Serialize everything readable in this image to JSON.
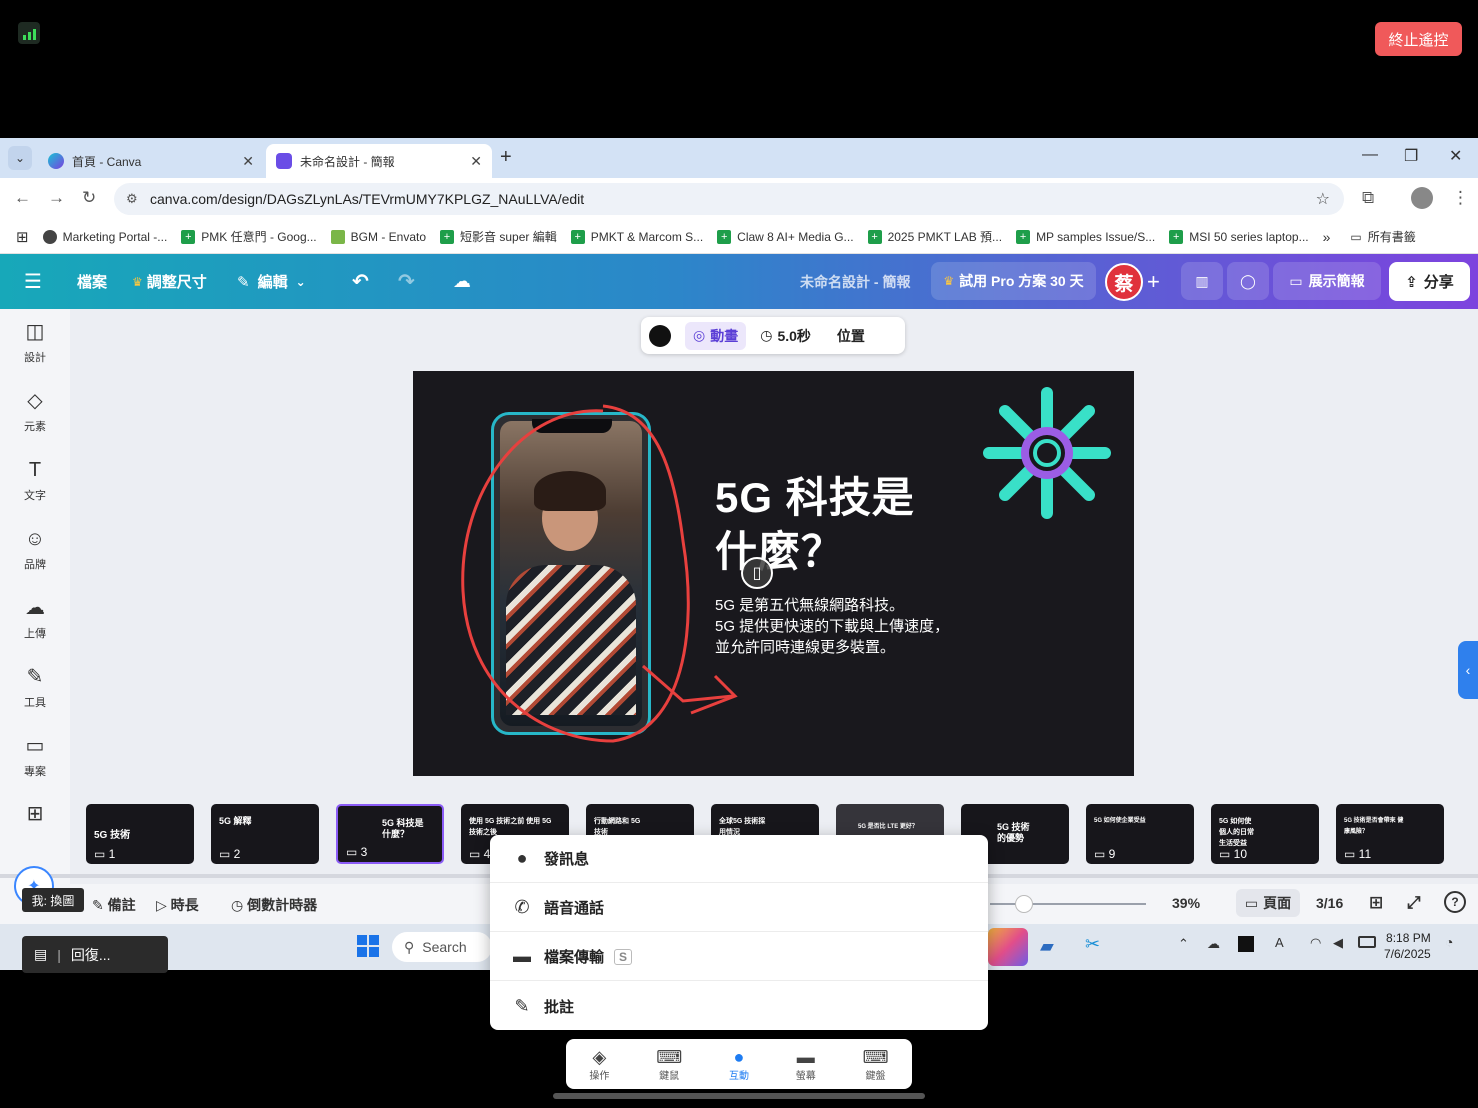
{
  "remote": {
    "stop_label": "終止遙控"
  },
  "browser": {
    "tabs": [
      {
        "title": "首頁 - Canva",
        "icon": "canva-icon"
      },
      {
        "title": "未命名設計 - 簡報",
        "icon": "canva-design-icon"
      }
    ],
    "url": "canva.com/design/DAGsZLynLAs/TEVrmUMY7KPLGZ_NAuLLVA/edit",
    "bookmarks": [
      "Marketing Portal -...",
      "PMK 任意門 - Goog...",
      "BGM - Envato",
      "短影音 super 編輯",
      "PMKT & Marcom S...",
      "Claw 8 AI+ Media G...",
      "2025 PMKT LAB 預...",
      "MP samples Issue/S...",
      "MSI 50 series laptop..."
    ],
    "all_bookmarks": "所有書籤"
  },
  "canva": {
    "menu": {
      "file": "檔案",
      "resize": "調整尺寸",
      "edit": "編輯"
    },
    "doc_title": "未命名設計 - 簡報",
    "trial": "試用 Pro 方案 30 天",
    "avatar": "蔡",
    "present": "展示簡報",
    "share": "分享",
    "sidebar": [
      "設計",
      "元素",
      "文字",
      "品牌",
      "上傳",
      "工具",
      "專案"
    ],
    "float_toolbar": {
      "animate": "動畫",
      "duration": "5.0秒",
      "position": "位置"
    },
    "slide": {
      "title_line1": "5G 科技是",
      "title_line2": "什麼？",
      "body_line1": "5G 是第五代無線網路科技。",
      "body_line2": "5G 提供更快速的下載與上傳速度，",
      "body_line3": "並允許同時連線更多裝置。"
    },
    "thumbnails": [
      {
        "text": "5G 技術",
        "num": "1"
      },
      {
        "text": "5G 解釋",
        "num": "2"
      },
      {
        "text": "5G 科技是什麼？",
        "num": "3"
      },
      {
        "text": "使用 5G 技術之前 使用 5G 技術之後",
        "num": "4"
      },
      {
        "text": "行動網路和 5G 技術",
        "num": ""
      },
      {
        "text": "全球5G 技術採用情況",
        "num": ""
      },
      {
        "text": "5G 是否比 LTE 更好？",
        "num": ""
      },
      {
        "text": "5G 技術 的優勢",
        "num": "8"
      },
      {
        "text": "5G 如何使企業受益",
        "num": "9"
      },
      {
        "text": "5G 如何使 個人的日常 生活受益",
        "num": "10"
      },
      {
        "text": "5G 技術是否會帶來 健康風險？",
        "num": "11"
      }
    ],
    "status": {
      "notes": "備註",
      "duration": "時長",
      "timer": "倒數計時器",
      "zoom": "39%",
      "page_mode": "頁面",
      "page_count": "3/16"
    }
  },
  "taskbar": {
    "search_placeholder": "Search",
    "time": "8:18 PM",
    "date": "7/6/2025"
  },
  "overlay": {
    "me_label": "我: 換圖",
    "toast": "回復...",
    "menu": [
      "發訊息",
      "語音通話",
      "檔案傳輸",
      "批註"
    ],
    "bottom_nav": [
      "操作",
      "鍵鼠",
      "互動",
      "螢幕",
      "鍵盤"
    ],
    "active_nav": "互動"
  }
}
